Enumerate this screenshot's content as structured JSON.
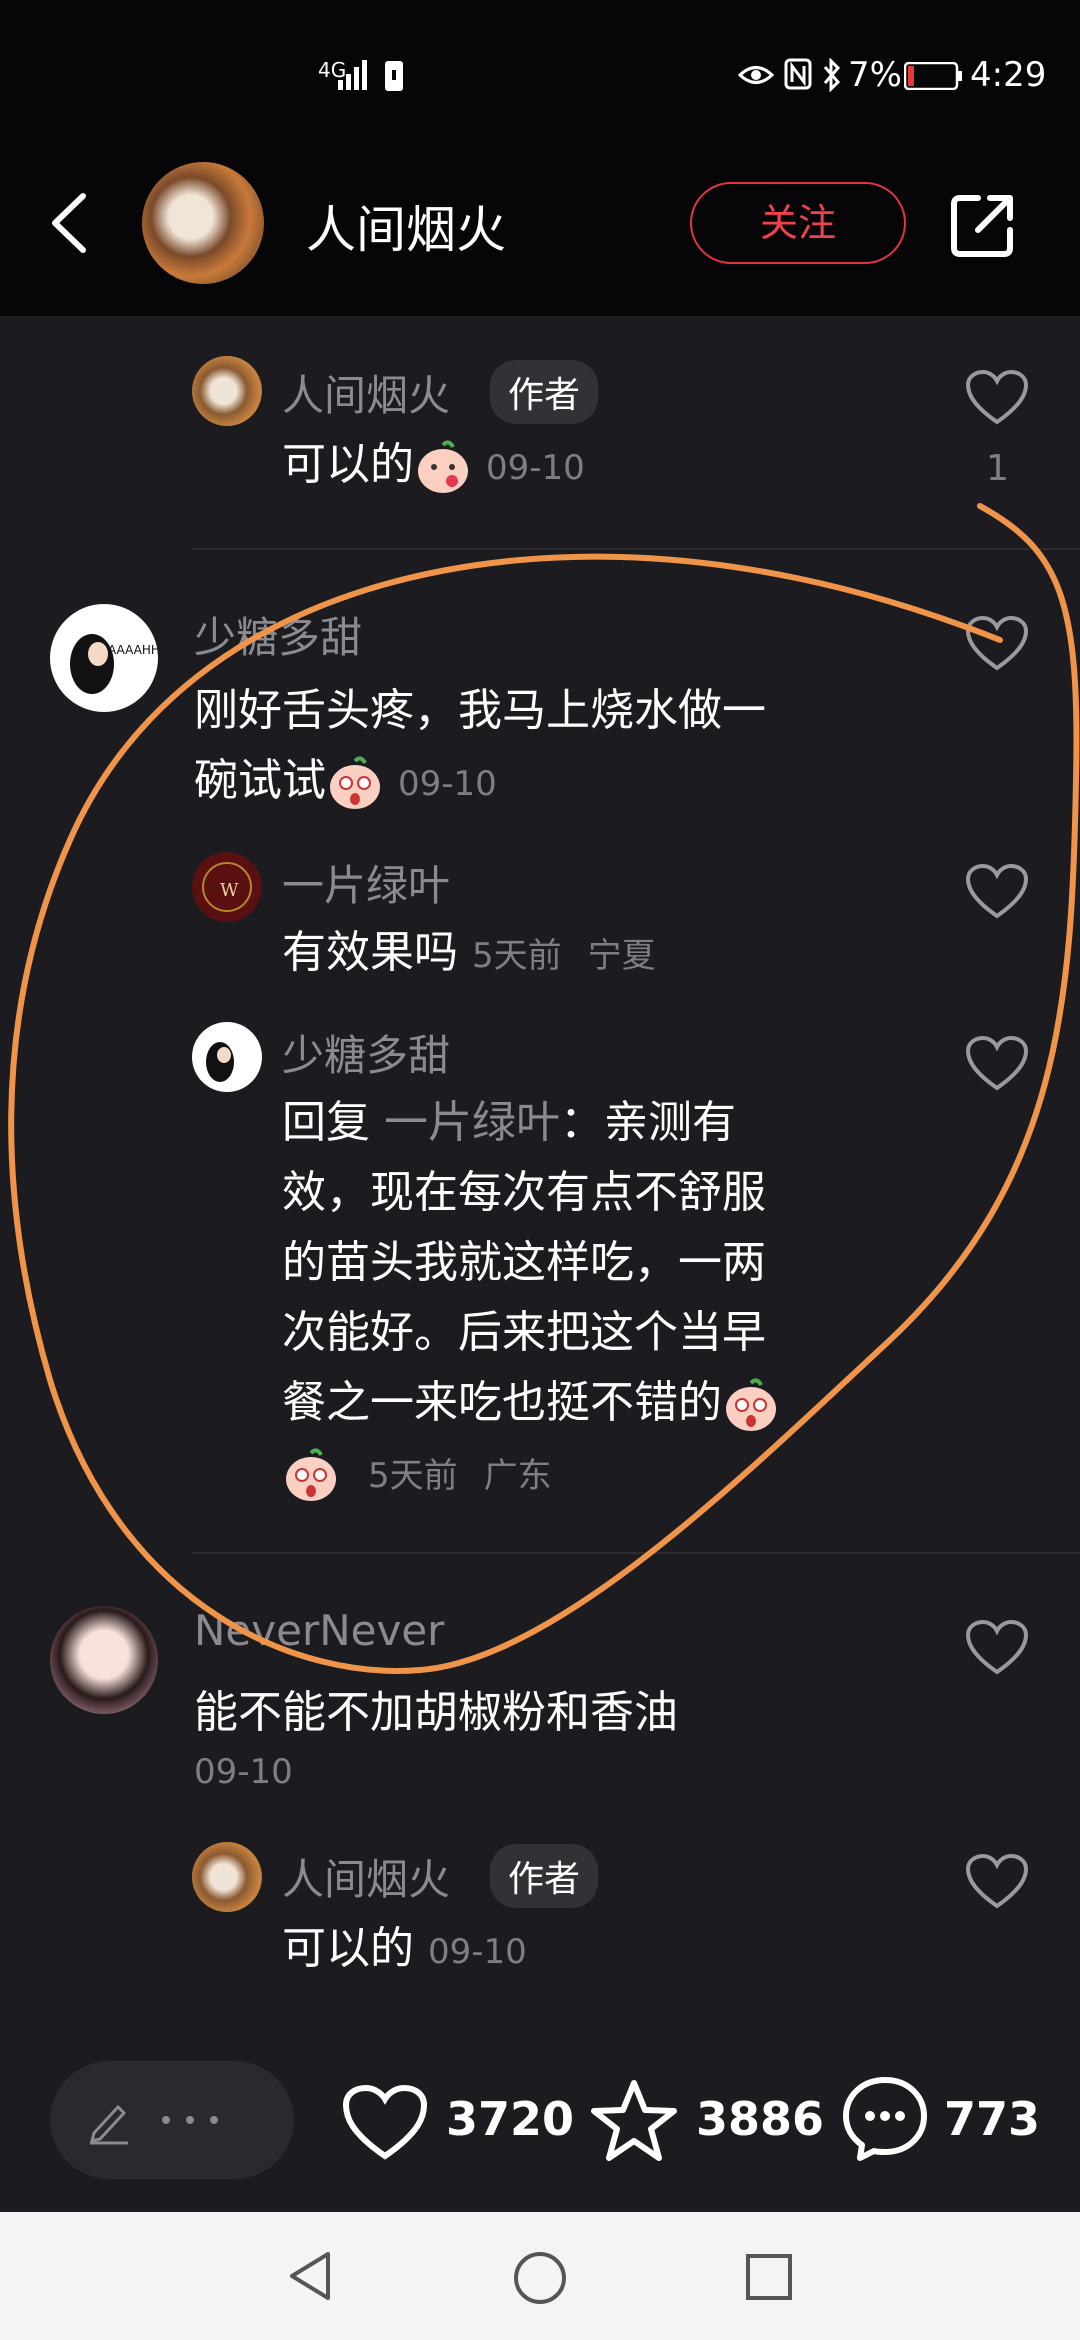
{
  "status_bar": {
    "network": "4G",
    "battery_percent": "7%",
    "time": "4:29"
  },
  "header": {
    "title": "人间烟火",
    "follow_label": "关注"
  },
  "comments": [
    {
      "id": "reply-author-1",
      "name": "人间烟火",
      "badge": "作者",
      "text": "可以的",
      "date": "09-10",
      "likes": "1"
    },
    {
      "id": "comment-shaotang",
      "name": "少糖多甜",
      "text_lines": [
        "刚好舌头疼，我马上烧水做一",
        "碗试试"
      ],
      "date": "09-10",
      "replies": [
        {
          "name": "一片绿叶",
          "text": "有效果吗",
          "time": "5天前",
          "location": "宁夏"
        },
        {
          "name": "少糖多甜",
          "reply_prefix": "回复",
          "reply_to": "一片绿叶",
          "reply_colon": "：",
          "text_lines": [
            "亲测有",
            "效，现在每次有点不舒服",
            "的苗头我就这样吃，一两",
            "次能好。后来把这个当早",
            "餐之一来吃也挺不错的"
          ],
          "time": "5天前",
          "location": "广东"
        }
      ]
    },
    {
      "id": "comment-never",
      "name": "NeverNever",
      "text": "能不能不加胡椒粉和香油",
      "date": "09-10",
      "replies": [
        {
          "name": "人间烟火",
          "badge": "作者",
          "text": "可以的",
          "date": "09-10"
        }
      ]
    }
  ],
  "bottom_bar": {
    "input_placeholder_icon": "pencil-icon",
    "likes": "3720",
    "stars": "3886",
    "comments": "773"
  },
  "colors": {
    "background": "#1c1c20",
    "header_bg": "#060608",
    "accent_red": "#e03542",
    "annotation_orange": "#f0944a"
  }
}
